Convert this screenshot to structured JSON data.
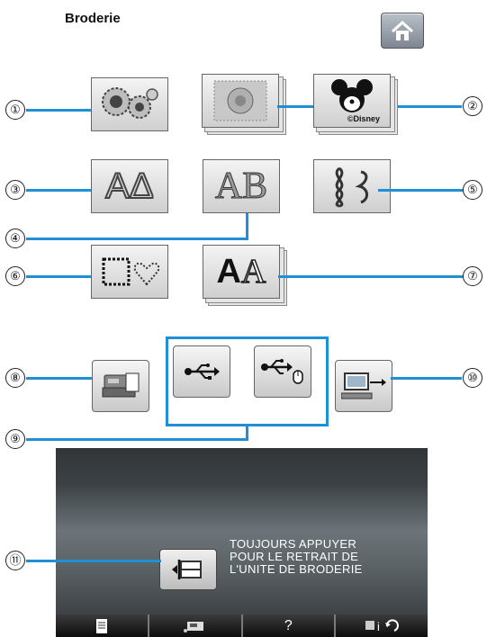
{
  "header": {
    "title": "Broderie",
    "home_icon": "home-icon"
  },
  "callouts": {
    "c1": "①",
    "c2": "②",
    "c3": "③",
    "c4": "④",
    "c5": "⑤",
    "c6": "⑥",
    "c7": "⑦",
    "c8": "⑧",
    "c9": "⑨",
    "c10": "⑩",
    "c11": "⑪"
  },
  "buttons": {
    "disney_caption": "©Disney",
    "frame_letters_1": "AΔ",
    "floral_letters": "AB",
    "font_letters_1": "A",
    "font_letters_2": "A"
  },
  "panel": {
    "message_lines": [
      "TOUJOURS APPUYER",
      "POUR LE RETRAIT DE",
      "L'UNITE DE BRODERIE"
    ]
  },
  "bottom_bar": {
    "help_label": "?",
    "icons": [
      "document-icon",
      "embroidery-machine-icon",
      "help-icon",
      "settings-info-icon"
    ]
  },
  "colors": {
    "callout_line": "#1f8fd6",
    "panel_dark": "#3c4145"
  }
}
